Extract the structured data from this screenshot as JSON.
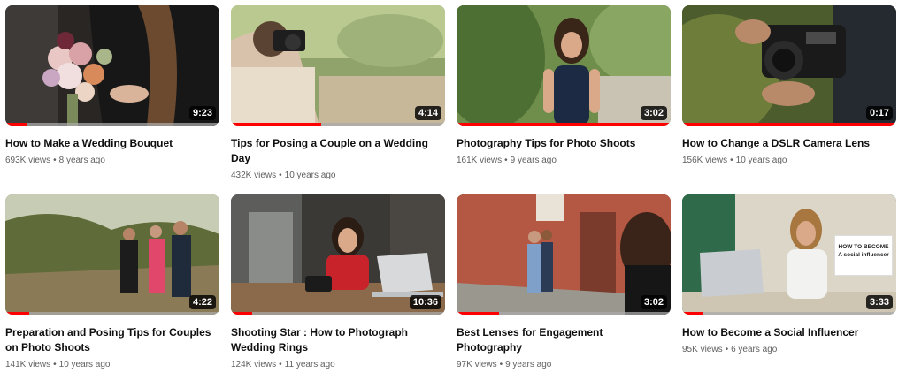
{
  "videos": [
    {
      "title": "How to Make a Wedding Bouquet",
      "duration": "9:23",
      "views": "693K views",
      "age": "8 years ago",
      "watched": 0.1
    },
    {
      "title": "Tips for Posing a Couple on a Wedding Day",
      "duration": "4:14",
      "views": "432K views",
      "age": "10 years ago",
      "watched": 0.42
    },
    {
      "title": "Photography Tips for Photo Shoots",
      "duration": "3:02",
      "views": "161K views",
      "age": "9 years ago",
      "watched": 1.0
    },
    {
      "title": "How to Change a DSLR Camera Lens",
      "duration": "0:17",
      "views": "156K views",
      "age": "10 years ago",
      "watched": 1.0
    },
    {
      "title": "Preparation and Posing Tips for Couples on Photo Shoots",
      "duration": "4:22",
      "views": "141K views",
      "age": "10 years ago",
      "watched": 0.11
    },
    {
      "title": "Shooting Star : How to Photograph Wedding Rings",
      "duration": "10:36",
      "views": "124K views",
      "age": "11 years ago",
      "watched": 0.1
    },
    {
      "title": "Best Lenses for Engagement Photography",
      "duration": "3:02",
      "views": "97K views",
      "age": "9 years ago",
      "watched": 0.2
    },
    {
      "title": "How to Become a Social Influencer",
      "duration": "3:33",
      "views": "95K views",
      "age": "6 years ago",
      "watched": 0.1,
      "thumb_text": "HOW TO BECOME A social influencer"
    }
  ],
  "meta_separator": "•",
  "colors": {
    "progress": "#ff0000",
    "title": "#0f0f0f",
    "meta": "#606060"
  }
}
